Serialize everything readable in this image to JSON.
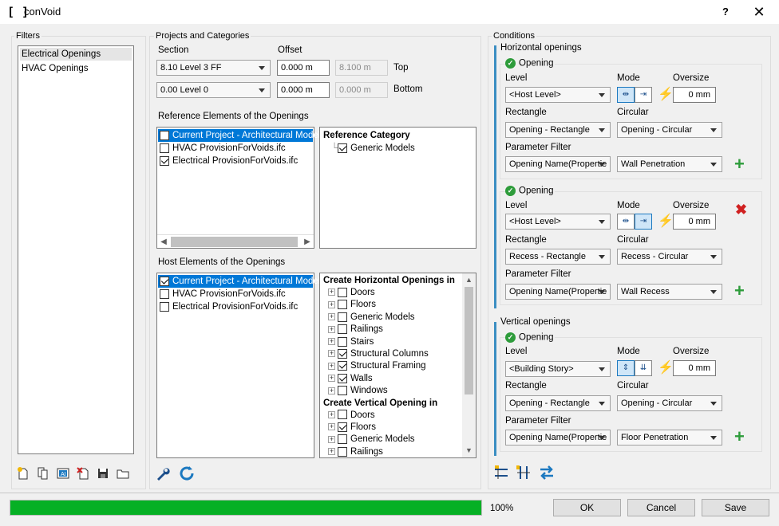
{
  "window": {
    "title": "conVoid",
    "icon_glyph": "[ ]",
    "help_label": "?",
    "close_label": "✕"
  },
  "filters": {
    "group_label": "Filters",
    "items": [
      {
        "label": "Electrical Openings",
        "selected": true
      },
      {
        "label": "HVAC Openings",
        "selected": false
      }
    ]
  },
  "projects": {
    "group_label": "Projects and Categories",
    "section_label": "Section",
    "offset_label": "Offset",
    "top_section": "8.10  Level 3 FF",
    "top_offset": "0.000 m",
    "top_value": "8.100 m",
    "top_label": "Top",
    "bottom_section": "0.00  Level 0",
    "bottom_offset": "0.000 m",
    "bottom_value": "0.000 m",
    "bottom_label": "Bottom",
    "ref_label": "Reference Elements of the Openings",
    "ref_files": [
      {
        "label": "Current Project - Architectural Model",
        "checked": false,
        "selected": true
      },
      {
        "label": "HVAC ProvisionForVoids.ifc",
        "checked": false,
        "selected": false
      },
      {
        "label": "Electrical ProvisionForVoids.ifc",
        "checked": true,
        "selected": false
      }
    ],
    "ref_category_title": "Reference Category",
    "ref_categories": [
      {
        "label": "Generic Models",
        "checked": true
      }
    ],
    "host_label": "Host Elements of the Openings",
    "host_files": [
      {
        "label": "Current Project - Architectural Model",
        "checked": true,
        "selected": true
      },
      {
        "label": "HVAC ProvisionForVoids.ifc",
        "checked": false,
        "selected": false
      },
      {
        "label": "Electrical ProvisionForVoids.ifc",
        "checked": false,
        "selected": false
      }
    ],
    "horizontal_title": "Create Horizontal Openings in",
    "horizontal_cats": [
      {
        "label": "Doors",
        "checked": false
      },
      {
        "label": "Floors",
        "checked": false
      },
      {
        "label": "Generic Models",
        "checked": false
      },
      {
        "label": "Railings",
        "checked": false
      },
      {
        "label": "Stairs",
        "checked": false
      },
      {
        "label": "Structural Columns",
        "checked": true
      },
      {
        "label": "Structural Framing",
        "checked": true
      },
      {
        "label": "Walls",
        "checked": true
      },
      {
        "label": "Windows",
        "checked": false
      }
    ],
    "vertical_title": "Create Vertical Opening in",
    "vertical_cats": [
      {
        "label": "Doors",
        "checked": false
      },
      {
        "label": "Floors",
        "checked": true
      },
      {
        "label": "Generic Models",
        "checked": false
      },
      {
        "label": "Railings",
        "checked": false
      }
    ]
  },
  "conditions": {
    "group_label": "Conditions",
    "horizontal_label": "Horizontal openings",
    "vertical_label": "Vertical openings",
    "opening_label": "Opening",
    "level_label": "Level",
    "mode_label": "Mode",
    "oversize_label": "Oversize",
    "rect_label": "Rectangle",
    "circ_label": "Circular",
    "param_label": "Parameter Filter",
    "h1": {
      "level": "<Host Level>",
      "oversize": "0 mm",
      "rect": "Opening - Rectangle",
      "circ": "Opening - Circular",
      "param": "Opening Name(Propertie",
      "value": "Wall Penetration"
    },
    "h2": {
      "level": "<Host Level>",
      "oversize": "0 mm",
      "rect": "Recess - Rectangle",
      "circ": "Recess - Circular",
      "param": "Opening Name(Propertie",
      "value": "Wall Recess"
    },
    "v1": {
      "level": "<Building Story>",
      "oversize": "0 mm",
      "rect": "Opening - Rectangle",
      "circ": "Opening - Circular",
      "param": "Opening Name(Propertie",
      "value": "Floor Penetration"
    }
  },
  "footer": {
    "progress": 1.0,
    "progress_label": "100%",
    "ok": "OK",
    "cancel": "Cancel",
    "save": "Save"
  },
  "colors": {
    "accent": "#0078d7",
    "progress": "#06b025",
    "add": "#2e9c3b",
    "delete": "#d02020"
  }
}
